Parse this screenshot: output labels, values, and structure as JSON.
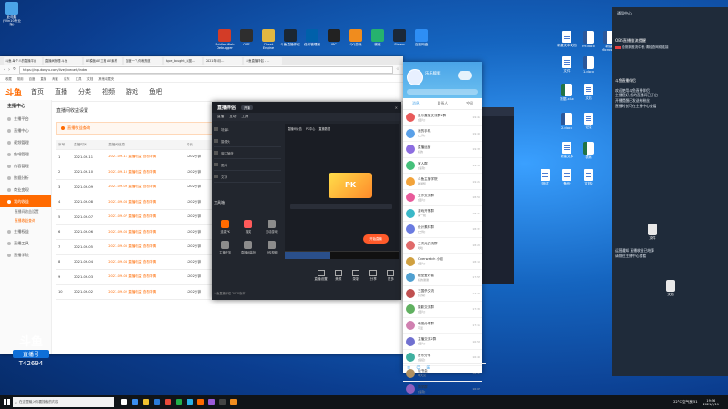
{
  "desktop": {
    "left_icons": [
      {
        "label": "此电脑 (Win10专业版)"
      }
    ],
    "top_icons": [
      {
        "label": "Fiddler Web Debugger",
        "color": "#d33c27"
      },
      {
        "label": "OBS",
        "color": "#2e2e2e"
      },
      {
        "label": "Cheat Engine",
        "color": "#e2b742"
      },
      {
        "label": "斗鱼直播伴侣",
        "color": "#1b2733"
      },
      {
        "label": "任务管理器",
        "color": "#0060aa"
      },
      {
        "label": "IPC",
        "color": "#222222"
      },
      {
        "label": "QQ游戏",
        "color": "#f08c1e"
      },
      {
        "label": "微信",
        "color": "#26b26e"
      },
      {
        "label": "Steam",
        "color": "#1b2838"
      },
      {
        "label": "百度网盘",
        "color": "#2e8ef5"
      }
    ],
    "right_files": [
      {
        "label": "新建文本文档",
        "type": "file"
      },
      {
        "label": "rrr.docx",
        "type": "word"
      },
      {
        "label": "新建 Microsoft",
        "type": "word"
      },
      {
        "label": "文件",
        "type": "file"
      },
      {
        "label": "1.docx",
        "type": "word"
      },
      {
        "label": "数据.xlsx",
        "type": "excel"
      },
      {
        "label": "文档",
        "type": "file"
      },
      {
        "label": "2.docx",
        "type": "word"
      },
      {
        "label": "记录",
        "type": "file"
      },
      {
        "label": "新建文本",
        "type": "file"
      },
      {
        "label": "表格",
        "type": "excel"
      },
      {
        "label": "备份",
        "type": "file"
      },
      {
        "label": "文档2",
        "type": "file"
      },
      {
        "label": "测试",
        "type": "file"
      }
    ],
    "panel_files": [
      {
        "label": "文件"
      },
      {
        "label": "文档"
      }
    ]
  },
  "browser": {
    "tabs": [
      "斗鱼-每个人的直播平台",
      "直播间管理-斗鱼",
      "AE模板 AE工程 AE素材",
      "百度一下,你就知道",
      "type_bought_以图…",
      "2021年6月…",
      "斗鱼直播伴侣 - …"
    ],
    "url": "https://mp.douyu.com/live/livecast/index",
    "bookmarks": [
      "收藏",
      "常用",
      "百度",
      "直播",
      "淘宝",
      "京东",
      "工具",
      "文档",
      "其他收藏夹"
    ],
    "nav": [
      "首页",
      "直播",
      "分类",
      "视频",
      "游戏",
      "鱼吧"
    ],
    "logo": "斗鱼",
    "sidebar_title": "主播中心",
    "sidebar": [
      {
        "label": "主播平台",
        "active": false
      },
      {
        "label": "直播中心",
        "active": false
      },
      {
        "label": "视频管理",
        "active": false
      },
      {
        "label": "鱼吧管理",
        "active": false
      },
      {
        "label": "内容管理",
        "active": false
      },
      {
        "label": "数据分析",
        "active": false
      },
      {
        "label": "商业变现",
        "active": false
      },
      {
        "label": "我的收益",
        "active": true
      }
    ],
    "sidebar_sub": [
      {
        "label": "直播间收益设置",
        "active": false
      },
      {
        "label": "直播收益查询",
        "active": true
      }
    ],
    "sidebar_more": [
      "主播权益",
      "直播工具",
      "直播学院"
    ],
    "page_title": "直播间收益设置",
    "section_title": "直播收益查询",
    "table_headers": [
      "序号",
      "直播时间",
      "直播间信息",
      "时长",
      "收益",
      "状态",
      "操作"
    ],
    "rows": [
      {
        "no": "1",
        "date": "2021-09-11",
        "info": "2021-09-11 直播收益 查看详情",
        "dur": "1202分钟",
        "inc": "0.00",
        "status": "已结算",
        "op": "查看"
      },
      {
        "no": "2",
        "date": "2021-09-10",
        "info": "2021-09-10 直播收益 查看详情",
        "dur": "1202分钟",
        "inc": "0.00",
        "status": "已结算",
        "op": "查看"
      },
      {
        "no": "3",
        "date": "2021-09-09",
        "info": "2021-09-09 直播收益 查看详情",
        "dur": "1202分钟",
        "inc": "0.00",
        "status": "已结算",
        "op": "查看"
      },
      {
        "no": "4",
        "date": "2021-09-08",
        "info": "2021-09-08 直播收益 查看详情",
        "dur": "1202分钟",
        "inc": "0.00",
        "status": "已结算",
        "op": "查看"
      },
      {
        "no": "5",
        "date": "2021-09-07",
        "info": "2021-09-07 直播收益 查看详情",
        "dur": "1202分钟",
        "inc": "0.00",
        "status": "已结算",
        "op": "查看"
      },
      {
        "no": "6",
        "date": "2021-09-06",
        "info": "2021-09-06 直播收益 查看详情",
        "dur": "1202分钟",
        "inc": "0.00",
        "status": "已结算",
        "op": "查看"
      },
      {
        "no": "7",
        "date": "2021-09-05",
        "info": "2021-09-05 直播收益 查看详情",
        "dur": "1202分钟",
        "inc": "0.00",
        "status": "已结算",
        "op": "查看"
      },
      {
        "no": "8",
        "date": "2021-09-04",
        "info": "2021-09-04 直播收益 查看详情",
        "dur": "1202分钟",
        "inc": "0.00",
        "status": "已结算",
        "op": "查看"
      },
      {
        "no": "9",
        "date": "2021-09-03",
        "info": "2021-09-03 直播收益 查看详情",
        "dur": "1202分钟",
        "inc": "0.00",
        "status": "已结算",
        "op": "查看"
      },
      {
        "no": "10",
        "date": "2021-09-02",
        "info": "2021-09-02 直播收益 查看详情",
        "dur": "1202分钟",
        "inc": "0.00",
        "status": "已结算",
        "op": "查看"
      }
    ]
  },
  "studio": {
    "title": "直播伴侣",
    "badge": "开播",
    "tabs": [
      "直播",
      "互动",
      "工具"
    ],
    "scenes": [
      "场景1",
      "摄像头",
      "窗口捕获",
      "图片",
      "文字"
    ],
    "preview_tabs": [
      "直播间公告",
      "PK中心",
      "直播数据"
    ],
    "start_button": "开始直播",
    "tools_title": "工具箱",
    "tools": [
      {
        "label": "连麦PK",
        "color": "#ff6a00"
      },
      {
        "label": "抽奖",
        "color": "#ff5a5a"
      },
      {
        "label": "互动游戏",
        "color": "#8c8c8c"
      },
      {
        "label": "主播任务",
        "color": "#8c8c8c"
      },
      {
        "label": "直播间装扮",
        "color": "#8c8c8c"
      },
      {
        "label": "上传视频",
        "color": "#8c8c8c"
      }
    ],
    "bottom": [
      "直播设置",
      "美颜",
      "录制",
      "分享",
      "更多"
    ],
    "footer_text": "斗鱼直播伴侣 2021版本"
  },
  "qq": {
    "nickname": "乐乐鲸鲸",
    "tabs": [
      "消息",
      "联系人",
      "空间"
    ],
    "contacts": [
      {
        "name": "鱼乐直播交流群1群",
        "msg": "[图片]",
        "time": "19:42",
        "color": "#e85a5a"
      },
      {
        "name": "我的手机",
        "msg": "[文件]",
        "time": "19:40",
        "color": "#5aa0e8"
      },
      {
        "name": "直播运营",
        "msg": "好的",
        "time": "19:38",
        "color": "#8c6de0"
      },
      {
        "name": "家人群",
        "msg": "[语音]",
        "time": "19:30",
        "color": "#45c07a"
      },
      {
        "name": "斗鱼主播学院",
        "msg": "新通知",
        "time": "19:22",
        "color": "#f2a33a"
      },
      {
        "name": "工作交流群",
        "msg": "[图片]",
        "time": "18:50",
        "color": "#e85a9a"
      },
      {
        "name": "游戏开黑群",
        "msg": "来一把",
        "time": "18:41",
        "color": "#3ab8c8"
      },
      {
        "name": "设计素材群",
        "msg": "[文件]",
        "time": "18:33",
        "color": "#6a7be0"
      },
      {
        "name": "二次元交流群",
        "msg": "哈哈",
        "time": "18:20",
        "color": "#e06a6a"
      },
      {
        "name": "Overwatch 小组",
        "msg": "[图片]",
        "time": "18:10",
        "color": "#d0a040"
      },
      {
        "name": "模型爱好者",
        "msg": "好的谢谢",
        "time": "17:55",
        "color": "#50a0d0"
      },
      {
        "name": "三国杀交流",
        "msg": "[表情]",
        "time": "17:40",
        "color": "#c05050"
      },
      {
        "name": "摄影交流群",
        "msg": "[图片]",
        "time": "17:30",
        "color": "#60b060"
      },
      {
        "name": "萌宠分享群",
        "msg": "可爱",
        "time": "17:12",
        "color": "#d080b0"
      },
      {
        "name": "主播交流2群",
        "msg": "[图片]",
        "time": "16:58",
        "color": "#7070d0"
      },
      {
        "name": "音乐分享",
        "msg": "[链接]",
        "time": "16:40",
        "color": "#40b0a0"
      },
      {
        "name": "读书会",
        "msg": "明天见",
        "time": "16:22",
        "color": "#b09060"
      },
      {
        "name": "同学群",
        "msg": "[语音]",
        "time": "16:05",
        "color": "#9060c0"
      }
    ]
  },
  "notif_panel": {
    "title": "通知中心",
    "items": [
      {
        "title": "OBS直播推流提醒",
        "body": "检测到推流中断,请检查网络连接",
        "color": "#e84040"
      },
      {
        "title": "斗鱼直播伴侣",
        "body": "欢迎使用斗鱼直播伴侣\n主播您好,您的直播间已开启\n开播提醒已发送给粉丝\n直播时长可在主播中心查看"
      }
    ],
    "bottom_text": "运营通知 直播收益已结算\n请前往主播中心查看"
  },
  "watermark": {
    "brand": "斗鱼",
    "sub": "直播号",
    "id": "T42694"
  },
  "taskbar": {
    "search_placeholder": "在这里输入你要搜索的内容",
    "apps": [
      {
        "color": "#ffffff"
      },
      {
        "color": "#3a8ef0"
      },
      {
        "color": "#f2c230"
      },
      {
        "color": "#2a7bd8"
      },
      {
        "color": "#e84a3a"
      },
      {
        "color": "#22b04a"
      },
      {
        "color": "#2bb0e8"
      },
      {
        "color": "#ff6a00"
      },
      {
        "color": "#9a5ad8"
      },
      {
        "color": "#444444"
      },
      {
        "color": "#f08c1e"
      }
    ],
    "weather": "22°C 空气良 51",
    "time": "19:56",
    "date": "2021/9/11"
  }
}
